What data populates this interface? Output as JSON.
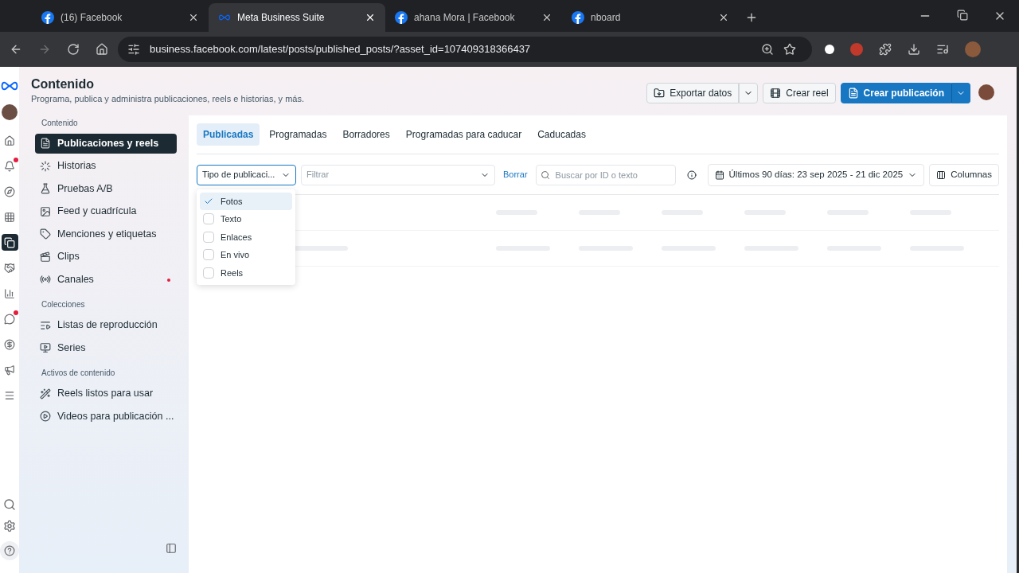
{
  "browser": {
    "tabs": [
      {
        "title": "(16) Facebook",
        "selected": false
      },
      {
        "title": "Meta Business Suite",
        "selected": true
      },
      {
        "title": "ahana Mora | Facebook",
        "selected": false
      },
      {
        "title": "nboard",
        "selected": false
      }
    ],
    "url": "business.facebook.com/latest/posts/published_posts/?asset_id=107409318366437"
  },
  "header": {
    "title": "Contenido",
    "subtitle": "Programa, publica y administra publicaciones, reels e historias, y más.",
    "buttons": [
      {
        "label": "Exportar datos",
        "kind": "secondary-split"
      },
      {
        "label": "Crear reel",
        "kind": "secondary"
      },
      {
        "label": "Crear publicación",
        "kind": "primary-split"
      }
    ]
  },
  "rail": {
    "items": [
      {
        "badge": false,
        "selected": false
      },
      {
        "badge": true,
        "selected": false
      },
      {
        "badge": false,
        "selected": false
      },
      {
        "badge": false,
        "selected": false
      },
      {
        "badge": false,
        "selected": true
      },
      {
        "badge": false,
        "selected": false
      },
      {
        "badge": false,
        "selected": false
      },
      {
        "badge": true,
        "selected": false
      },
      {
        "badge": false,
        "selected": false
      },
      {
        "badge": false,
        "selected": false
      },
      {
        "badge": false,
        "selected": false
      }
    ]
  },
  "sidebar": {
    "sections": [
      {
        "heading": "Contenido",
        "items": [
          {
            "label": "Publicaciones y reels",
            "selected": true,
            "dot": false
          },
          {
            "label": "Historias",
            "selected": false,
            "dot": false
          },
          {
            "label": "Pruebas A/B",
            "selected": false,
            "dot": false
          },
          {
            "label": "Feed y cuadrícula",
            "selected": false,
            "dot": false
          },
          {
            "label": "Menciones y etiquetas",
            "selected": false,
            "dot": false
          },
          {
            "label": "Clips",
            "selected": false,
            "dot": false
          },
          {
            "label": "Canales",
            "selected": false,
            "dot": true
          }
        ]
      },
      {
        "heading": "Colecciones",
        "items": [
          {
            "label": "Listas de reproducción",
            "selected": false,
            "dot": false
          },
          {
            "label": "Series",
            "selected": false,
            "dot": false
          }
        ]
      },
      {
        "heading": "Activos de contenido",
        "items": [
          {
            "label": "Reels listos para usar",
            "selected": false,
            "dot": false
          },
          {
            "label": "Videos para publicación ...",
            "selected": false,
            "dot": false
          }
        ]
      }
    ]
  },
  "content_tabs": [
    {
      "label": "Publicadas",
      "selected": true
    },
    {
      "label": "Programadas",
      "selected": false
    },
    {
      "label": "Borradores",
      "selected": false
    },
    {
      "label": "Programadas para caducar",
      "selected": false
    },
    {
      "label": "Caducadas",
      "selected": false
    }
  ],
  "filters": {
    "type_select": "Tipo de publicaci...",
    "filter_placeholder": "Filtrar",
    "clear": "Borrar",
    "search_placeholder": "Buscar por ID o texto",
    "date_range": "Últimos 90 días: 23 sep 2025 - 21 dic 2025",
    "columns": "Columnas"
  },
  "type_menu": [
    {
      "label": "Fotos",
      "checked": true,
      "selected": true
    },
    {
      "label": "Texto",
      "checked": false,
      "selected": false
    },
    {
      "label": "Enlaces",
      "checked": false,
      "selected": false
    },
    {
      "label": "En vivo",
      "checked": false,
      "selected": false
    },
    {
      "label": "Reels",
      "checked": false,
      "selected": false
    }
  ]
}
